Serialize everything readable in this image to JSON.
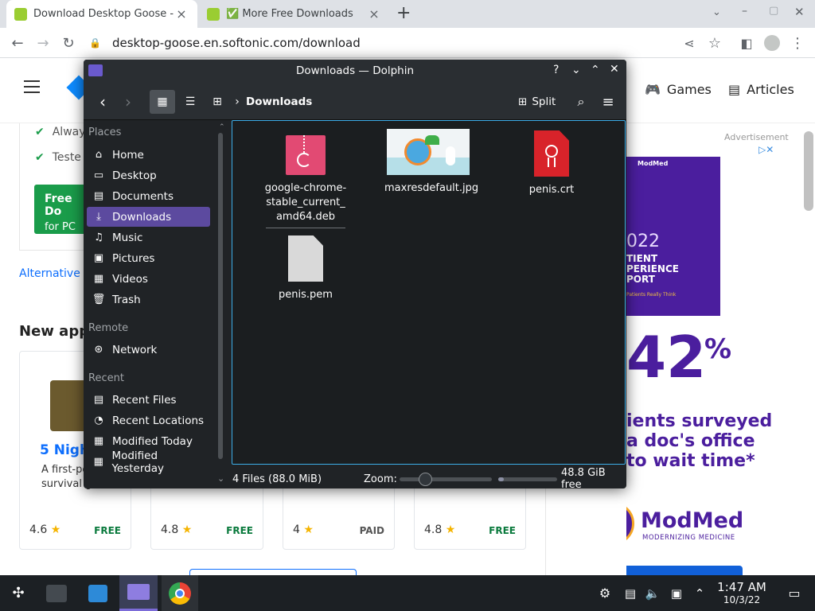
{
  "browser": {
    "tabs": [
      {
        "title": "Download Desktop Goose - fr",
        "active": true
      },
      {
        "title": "✅ More Free Downloads",
        "active": false
      }
    ],
    "url": "desktop-goose.en.softonic.com/download"
  },
  "website": {
    "nav_games": "Games",
    "nav_articles": "Articles",
    "check1": "Alway",
    "check2": "Teste",
    "free_download_line1": "Free Do",
    "free_download_line2": "for PC",
    "alternative_link": "Alternative D",
    "new_apps_heading": "New apps",
    "app_title": "5 Night",
    "app_desc": "A first-pe survival g",
    "cards": [
      {
        "rating": "4.6",
        "price": "FREE"
      },
      {
        "rating": "4.8",
        "price": "FREE"
      },
      {
        "rating": "4",
        "price": "PAID"
      },
      {
        "rating": "4.8",
        "price": "FREE"
      }
    ],
    "ad_label": "Advertisement",
    "ad": {
      "year": "022",
      "lines": [
        "TIENT",
        "PERIENCE",
        "PORT"
      ],
      "tagline": "Patients Really Think",
      "big": "42",
      "pct": "%",
      "text_lines": [
        "ients surveyed",
        "a doc's office",
        "to wait time*"
      ],
      "brand": "ModMed",
      "brand_sub": "MODERNIZING MEDICINE"
    }
  },
  "dolphin": {
    "title": "Downloads — Dolphin",
    "breadcrumb": "Downloads",
    "split_label": "Split",
    "sections": {
      "places": "Places",
      "remote": "Remote",
      "recent": "Recent"
    },
    "places": [
      "Home",
      "Desktop",
      "Documents",
      "Downloads",
      "Music",
      "Pictures",
      "Videos",
      "Trash"
    ],
    "remote": [
      "Network"
    ],
    "recent": [
      "Recent Files",
      "Recent Locations",
      "Modified Today",
      "Modified Yesterday"
    ],
    "selected_place": "Downloads",
    "files": [
      {
        "name": "google-chrome-stable_current_amd64.deb",
        "lines": [
          "google-chrome-",
          "stable_current_",
          "amd64.deb"
        ]
      },
      {
        "name": "maxresdefault.jpg"
      },
      {
        "name": "penis.crt"
      },
      {
        "name": "penis.pem"
      }
    ],
    "status_count": "4 Files (88.0 MiB)",
    "zoom_label": "Zoom:",
    "free_space": "48.8 GiB free",
    "free_space_fraction": 0.1
  },
  "taskbar": {
    "time": "1:47 AM",
    "date": "10/3/22"
  }
}
